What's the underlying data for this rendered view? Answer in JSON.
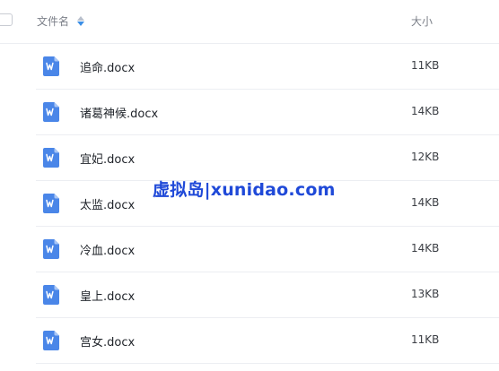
{
  "header": {
    "name_label": "文件名",
    "size_label": "大小"
  },
  "files": [
    {
      "name": "追命.docx",
      "size": "11KB",
      "icon": "word-doc-icon"
    },
    {
      "name": "诸葛神候.docx",
      "size": "14KB",
      "icon": "word-doc-icon"
    },
    {
      "name": "宜妃.docx",
      "size": "12KB",
      "icon": "word-doc-icon"
    },
    {
      "name": "太监.docx",
      "size": "14KB",
      "icon": "word-doc-icon"
    },
    {
      "name": "冷血.docx",
      "size": "14KB",
      "icon": "word-doc-icon"
    },
    {
      "name": "皇上.docx",
      "size": "13KB",
      "icon": "word-doc-icon"
    },
    {
      "name": "宫女.docx",
      "size": "11KB",
      "icon": "word-doc-icon"
    }
  ],
  "watermark": "虚拟岛|xunidao.com",
  "colors": {
    "icon_blue": "#4a86e8",
    "watermark": "#1f49d8",
    "sort_active": "#3a8ee6"
  }
}
